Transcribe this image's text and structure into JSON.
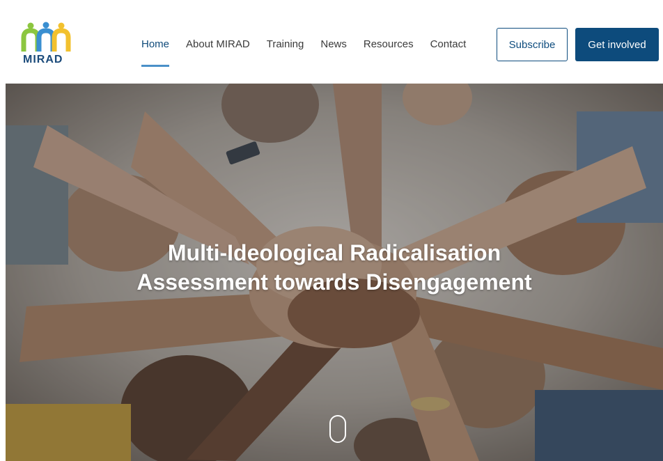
{
  "brand": {
    "name": "MIRAD",
    "colors": {
      "primary": "#0d4b7c",
      "accent": "#4a90c8",
      "logo_green": "#8cc63f",
      "logo_yellow": "#f2c12e",
      "logo_blue": "#3a8fd1"
    }
  },
  "nav": {
    "items": [
      {
        "label": "Home",
        "active": true
      },
      {
        "label": "About MIRAD",
        "active": false
      },
      {
        "label": "Training",
        "active": false
      },
      {
        "label": "News",
        "active": false
      },
      {
        "label": "Resources",
        "active": false
      },
      {
        "label": "Contact",
        "active": false
      }
    ]
  },
  "buttons": {
    "subscribe": "Subscribe",
    "get_involved": "Get involved"
  },
  "hero": {
    "title_line1": "Multi-Ideological Radicalisation",
    "title_line2": "Assessment towards Disengagement",
    "background": "photo of diverse group of people stacking hands together, viewed from below",
    "scroll_icon": "mouse-scroll-icon"
  }
}
